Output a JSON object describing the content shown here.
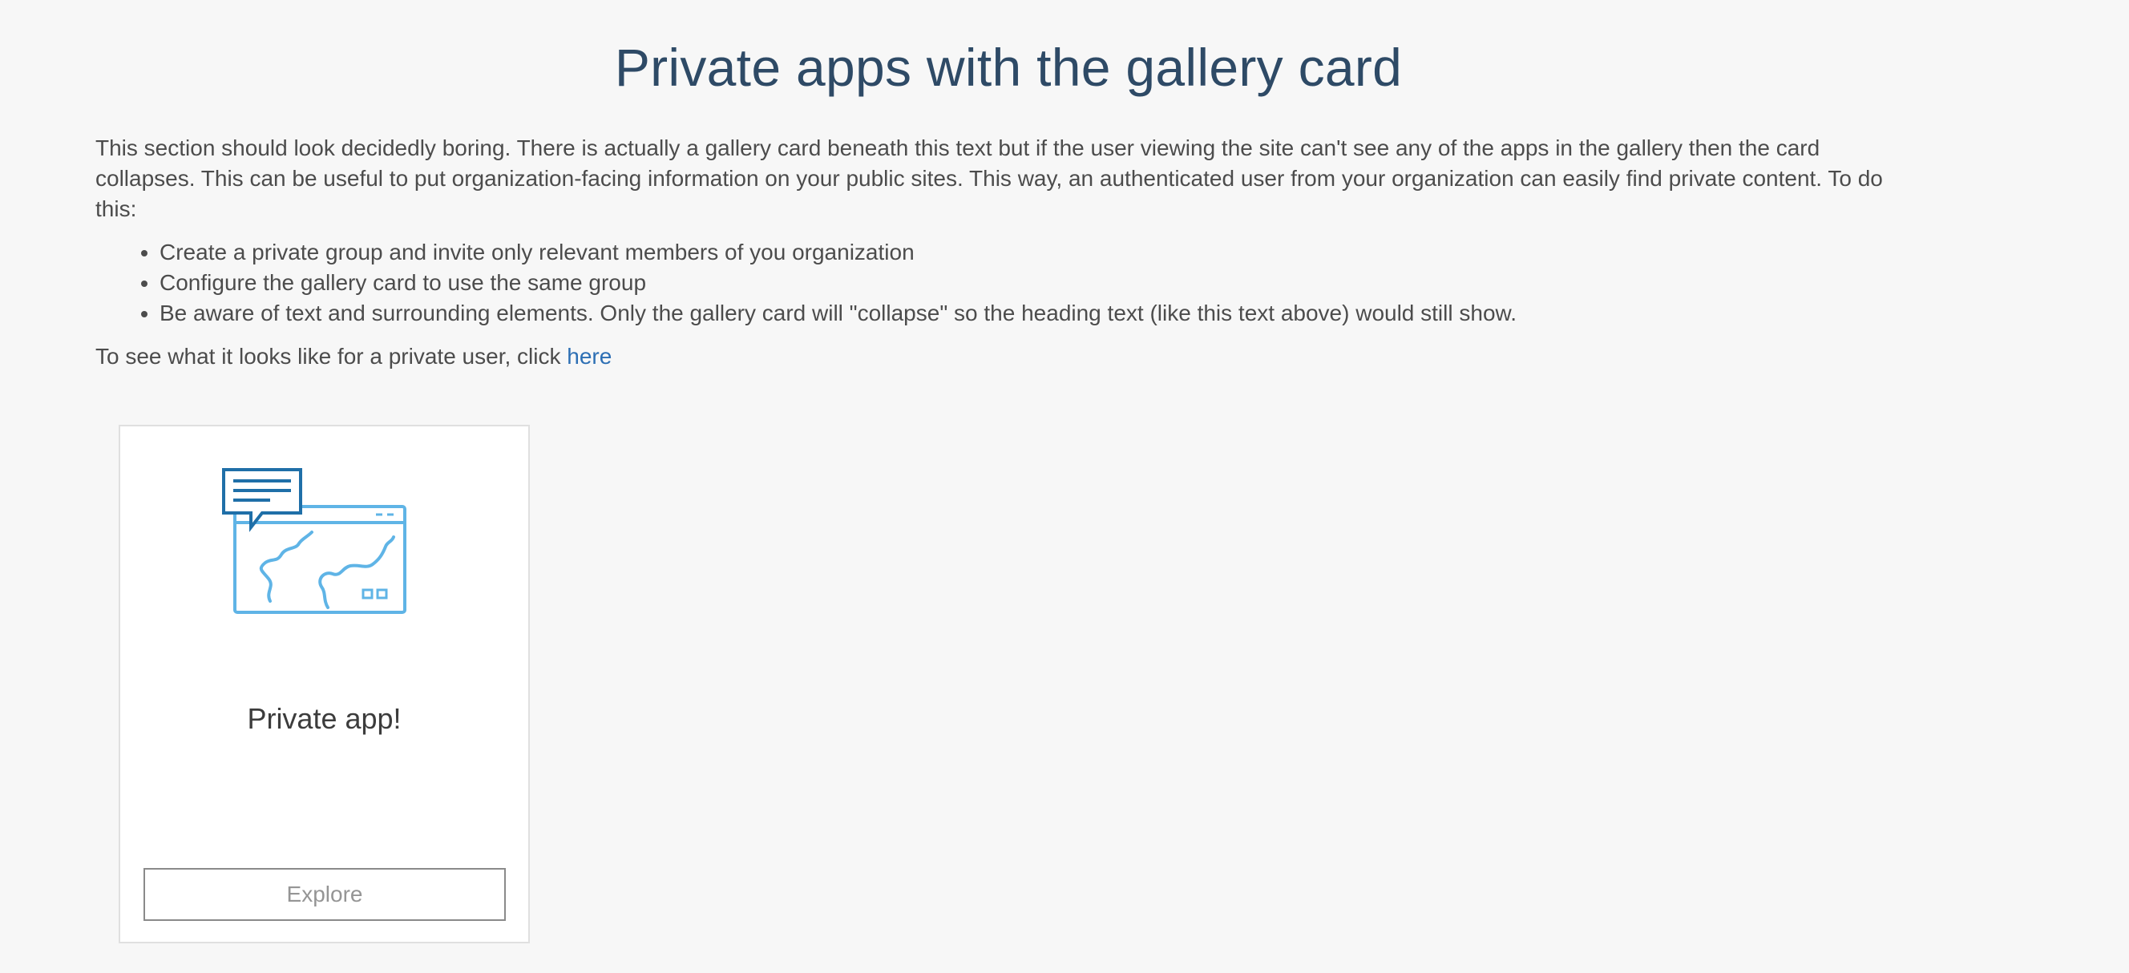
{
  "heading": "Private apps with the gallery card",
  "intro": "This section should look decidedly boring. There is actually a gallery card beneath this text but if the user viewing the site can't see any of the apps in the gallery then the card collapses. This can be useful to put organization-facing information on your public sites. This way, an authenticated user from your organization can easily find private content. To do this:",
  "steps": [
    "Create a private group and invite only relevant members of you organization",
    "Configure the gallery card to use the same group",
    "Be aware of text and surrounding elements. Only the gallery card will \"collapse\" so the heading text (like this text above) would still show."
  ],
  "private_user": {
    "text": "To see what it looks like for a private user, click ",
    "link_text": "here"
  },
  "gallery_card": {
    "image_icon": "map-app-with-chat-bubble-icon",
    "title": "Private app!",
    "button_label": "Explore"
  },
  "colors": {
    "background": "#f7f7f7",
    "heading": "#2e4a66",
    "link": "#2d6fb4",
    "icon_dark": "#1f6fa8",
    "icon_light": "#5fb4e6"
  }
}
